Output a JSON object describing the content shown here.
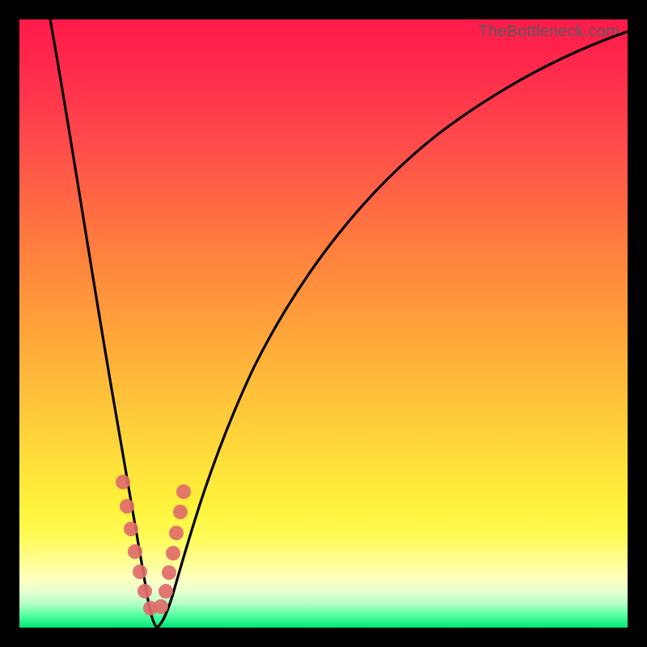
{
  "watermark": "TheBottleneck.com",
  "chart_data": {
    "type": "line",
    "title": "",
    "xlabel": "",
    "ylabel": "",
    "xlim": [
      0,
      100
    ],
    "ylim": [
      0,
      100
    ],
    "comment": "V-shaped bottleneck curve; y is distance from optimal pairing (0 = ideal). Minimum near x≈22. Values estimated from pixel gridlines.",
    "series": [
      {
        "name": "bottleneck-curve",
        "x": [
          5,
          8,
          12,
          16,
          18,
          20,
          22,
          24,
          26,
          28,
          32,
          40,
          50,
          60,
          72,
          85,
          100
        ],
        "y": [
          100,
          80,
          55,
          30,
          18,
          7,
          0,
          3,
          10,
          20,
          36,
          58,
          73,
          82,
          89,
          94,
          98
        ]
      }
    ],
    "markers": {
      "name": "highlighted-points",
      "color": "#e06666",
      "x": [
        17.0,
        17.6,
        18.3,
        19.0,
        19.8,
        20.6,
        21.6,
        23.2,
        24.0,
        24.6,
        25.2,
        25.8,
        26.4,
        27.0
      ],
      "y": [
        24.0,
        20.0,
        16.2,
        12.6,
        9.2,
        6.0,
        3.2,
        3.4,
        6.0,
        9.0,
        12.2,
        15.6,
        19.0,
        22.4
      ]
    },
    "gradient_scale": {
      "top_color": "#ff1a4b",
      "bottom_color": "#00e878",
      "meaning": "red = high bottleneck, green = balanced"
    }
  }
}
